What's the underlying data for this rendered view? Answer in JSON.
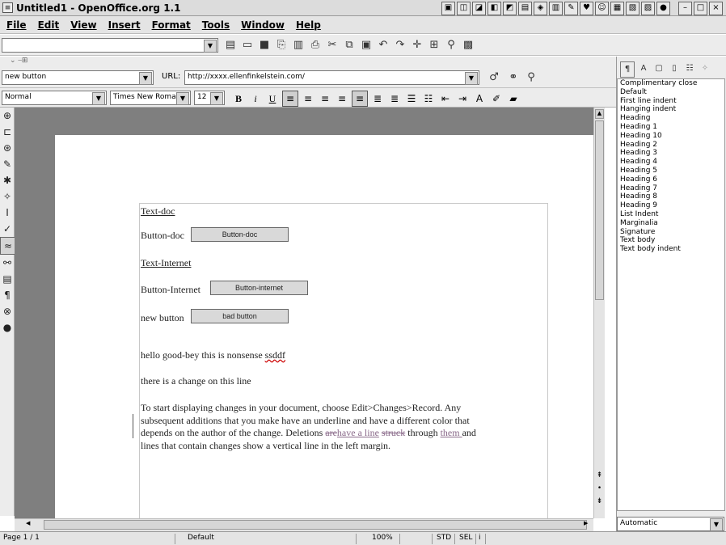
{
  "window": {
    "title": "Untitled1 - OpenOffice.org 1.1"
  },
  "menu": [
    "File",
    "Edit",
    "View",
    "Insert",
    "Format",
    "Tools",
    "Window",
    "Help"
  ],
  "hyperlink_bar": {
    "name_value": "new button",
    "url_label": "URL:",
    "url_value": "http://xxxx.ellenfinkelstein.com/"
  },
  "format_bar": {
    "style": "Normal",
    "font": "Times New Roman",
    "size": "12",
    "bold": "B",
    "italic": "i",
    "underline": "U"
  },
  "document": {
    "text_doc": "Text-doc",
    "button_doc_label": "Button-doc",
    "button_doc": "Button-doc",
    "text_internet": "Text-Internet",
    "button_internet_label": "Button-Internet",
    "button_internet": "Button-internet",
    "new_button_label": "new button",
    "bad_button": "bad button",
    "hello": "hello good-bey this is nonsense ",
    "hello_misspelled": "ssddf",
    "change_line": "there is a change on this line",
    "para_1": "To start displaying changes in your document, choose Edit>Changes>Record. Any",
    "para_2": "subsequent additions that you make have an underline and have a different color that",
    "para_3": "depends on the author of the change. Deletions ",
    "para_3_deleted": "are",
    "para_3_inserted": "have a line",
    "para_3_space": " ",
    "para_3_deleted2": "struck",
    "para_3_through": " through ",
    "para_3_inserted2": "them ",
    "para_3_end": "and",
    "para_4": "lines that contain changes show a vertical line in the left margin."
  },
  "stylist": {
    "styles": [
      "Complimentary close",
      "Default",
      "First line indent",
      "Hanging indent",
      "Heading",
      "Heading 1",
      "Heading 10",
      "Heading 2",
      "Heading 3",
      "Heading 4",
      "Heading 5",
      "Heading 6",
      "Heading 7",
      "Heading 8",
      "Heading 9",
      "List Indent",
      "Marginalia",
      "Signature",
      "Text body",
      "Text body indent"
    ],
    "filter": "Automatic"
  },
  "status": {
    "page": "Page 1 / 1",
    "style": "Default",
    "zoom": "100%",
    "mode": "STD",
    "sel": "SEL"
  }
}
